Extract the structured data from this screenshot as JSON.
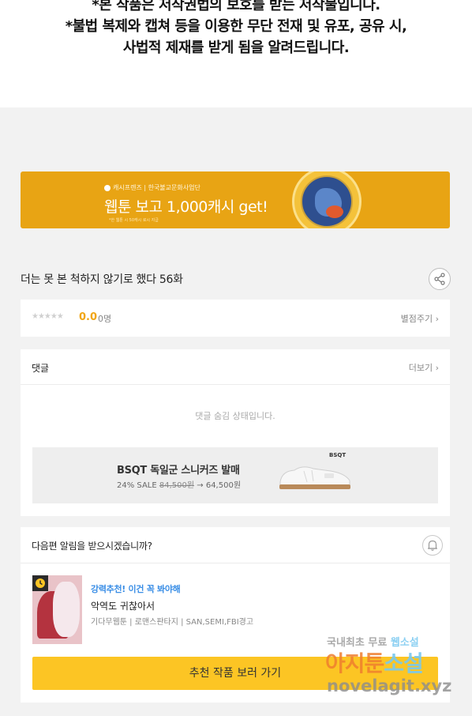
{
  "notice": {
    "line1": "*본 작품은 저작권법의 보호를 받는 저작물입니다.",
    "line2": "*불법 복제와 캡쳐 등을 이용한 무단 전재 및 유포, 공유 시,",
    "line3": "사법적 제재를 받게 됨을 알려드립니다."
  },
  "banner": {
    "sponsor": "캐시프렌즈 | 한국불교문화사업단",
    "headline": "웹툰 보고 1,000캐시 get!",
    "fine_print": "*한 웹툰 시 50캐시 로시 지급",
    "accent_color": "#e8a414"
  },
  "episode": {
    "title": "더는 못 본 척하지 않기로 했다 56화",
    "share_icon": "share-icon"
  },
  "rating": {
    "stars": "★★★★★",
    "score": "0.0",
    "count": "0명",
    "rate_link": "별점주기 ›",
    "score_color": "#f1a512"
  },
  "comments": {
    "title": "댓글",
    "more": "더보기 ›",
    "hidden_msg": "댓글 숨김 상태입니다."
  },
  "ad": {
    "brand": "BSQT",
    "title": "BSQT 독일군 스니커즈 발매",
    "discount": "24% SALE",
    "original_price": "84,500원",
    "arrow": "→",
    "sale_price": "64,500원"
  },
  "next": {
    "question": "다음편 알림을 받으시겠습니까?",
    "bell_icon": "bell-icon",
    "rec_tag": "강력추천! 이건 꼭 봐야해",
    "rec_name": "악역도 귀찮아서",
    "rec_meta": "기다무웹툰 | 로맨스판타지 | SAN,SEMI,FBI경고",
    "button": "추천 작품 보러 가기",
    "button_color": "#fcc524"
  },
  "watermark": {
    "line1_pre": "국내최초 무료",
    "line1_hl": "웹소설",
    "line2_pre": "아지툰",
    "line2_hl": "소설",
    "line3": "novelagit.xyz"
  }
}
